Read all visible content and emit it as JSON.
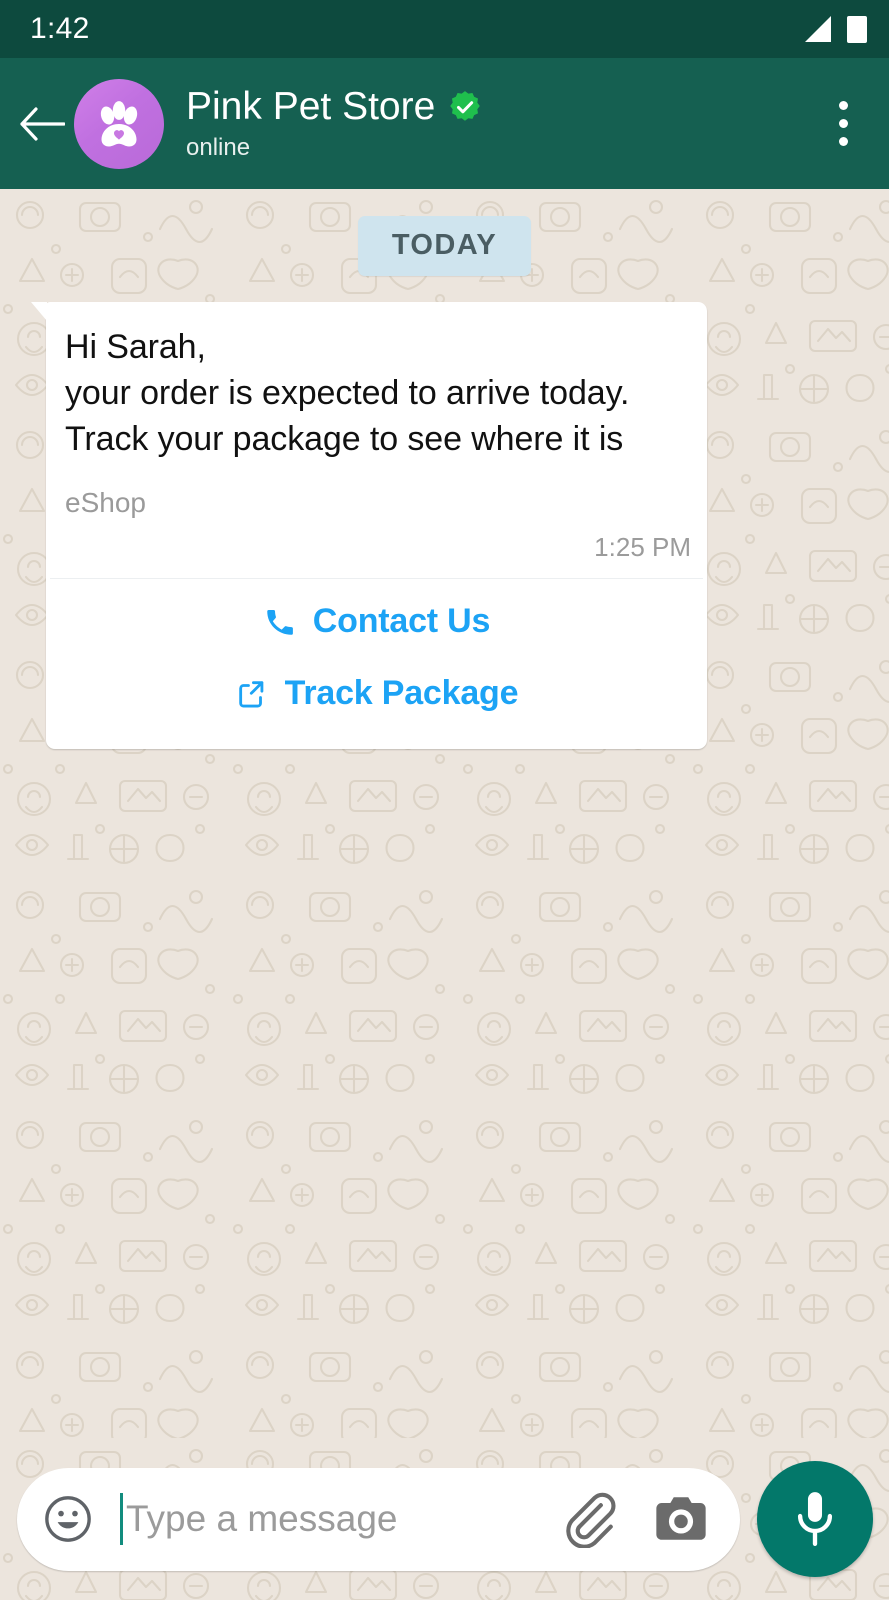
{
  "status_bar": {
    "clock": "1:42",
    "signal_icon": "signal-triangle-icon",
    "battery_icon": "battery-full-icon"
  },
  "header": {
    "back_icon": "back-arrow-icon",
    "avatar_icon": "paw-print-avatar",
    "title": "Pink Pet Store",
    "verified_icon": "verified-badge-icon",
    "subtitle": "online",
    "menu_icon": "overflow-menu-icon"
  },
  "chat": {
    "date_divider": "TODAY",
    "message": {
      "text": "Hi Sarah,\nyour order is expected to arrive today. Track your package to see where it is",
      "footer": "eShop",
      "time": "1:25 PM",
      "actions": [
        {
          "label": "Contact Us",
          "icon": "phone-icon"
        },
        {
          "label": "Track Package",
          "icon": "external-link-icon"
        }
      ]
    }
  },
  "composer": {
    "emoji_icon": "emoji-smiley-icon",
    "placeholder": "Type a message",
    "attach_icon": "paperclip-icon",
    "camera_icon": "camera-icon",
    "mic_icon": "microphone-icon"
  },
  "colors": {
    "status_bar": "#0d4a3e",
    "header": "#156051",
    "chat_background": "#ece5dd",
    "bubble": "#ffffff",
    "action_link": "#1ca3f5",
    "date_chip": "#cfe4ee",
    "mic_button": "#03786a",
    "verified": "#1fbf4d",
    "avatar": "#c070e0"
  }
}
